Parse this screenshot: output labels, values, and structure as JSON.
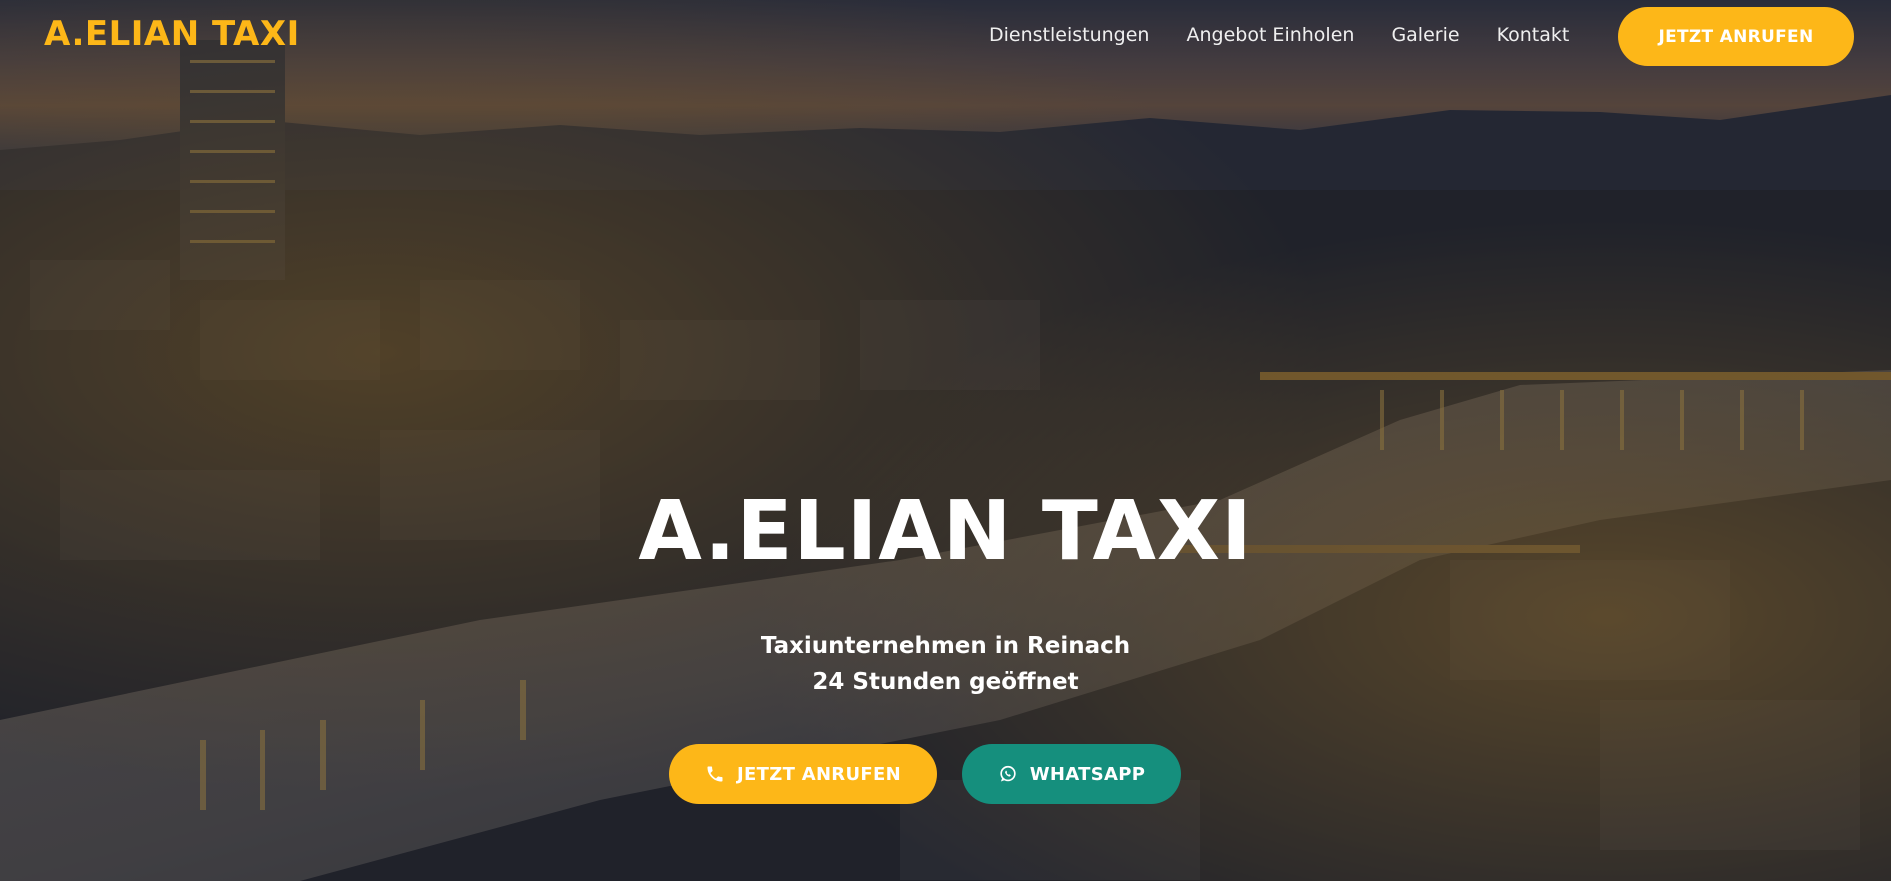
{
  "colors": {
    "brand_yellow": "#fdb718",
    "whatsapp_green": "#158f7d",
    "text_white": "#ffffff"
  },
  "header": {
    "logo": "A.ELIAN TAXI",
    "nav": [
      {
        "label": "Dienstleistungen"
      },
      {
        "label": "Angebot Einholen"
      },
      {
        "label": "Galerie"
      },
      {
        "label": "Kontakt"
      }
    ],
    "cta_label": "JETZT ANRUFEN"
  },
  "hero": {
    "title": "A.ELIAN TAXI",
    "subtitle_line1": "Taxiunternehmen in Reinach",
    "subtitle_line2": "24 Stunden geöffnet",
    "call_button": {
      "label": "JETZT ANRUFEN",
      "icon": "phone-icon"
    },
    "whatsapp_button": {
      "label": "WHATSAPP",
      "icon": "whatsapp-icon"
    }
  }
}
